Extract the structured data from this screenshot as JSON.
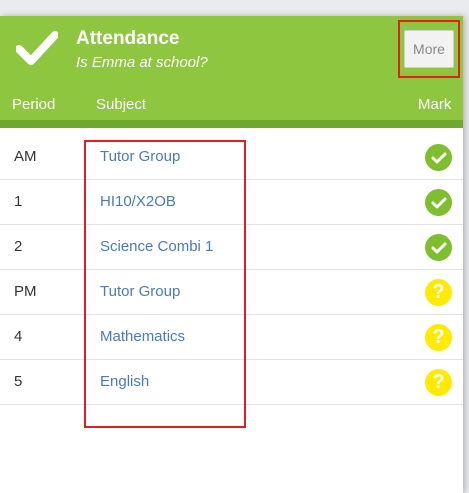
{
  "header": {
    "title": "Attendance",
    "subtitle": "Is Emma at school?",
    "more_label": "More",
    "bg_color": "#8ec63f",
    "check_icon": "check-icon"
  },
  "columns": {
    "period": "Period",
    "subject": "Subject",
    "mark": "Mark"
  },
  "rows": [
    {
      "period": "AM",
      "subject": "Tutor Group",
      "mark": "present",
      "mark_text": ""
    },
    {
      "period": "1",
      "subject": "HI10/X2OB",
      "mark": "present",
      "mark_text": ""
    },
    {
      "period": "2",
      "subject": "Science Combi 1",
      "mark": "present",
      "mark_text": ""
    },
    {
      "period": "PM",
      "subject": "Tutor Group",
      "mark": "unknown",
      "mark_text": "?"
    },
    {
      "period": "4",
      "subject": "Mathematics",
      "mark": "unknown",
      "mark_text": "?"
    },
    {
      "period": "5",
      "subject": "English",
      "mark": "unknown",
      "mark_text": "?"
    }
  ],
  "colors": {
    "present": "#7fbf2f",
    "unknown": "#ffea00",
    "link": "#4b7ab8",
    "highlight": "#e02020"
  }
}
